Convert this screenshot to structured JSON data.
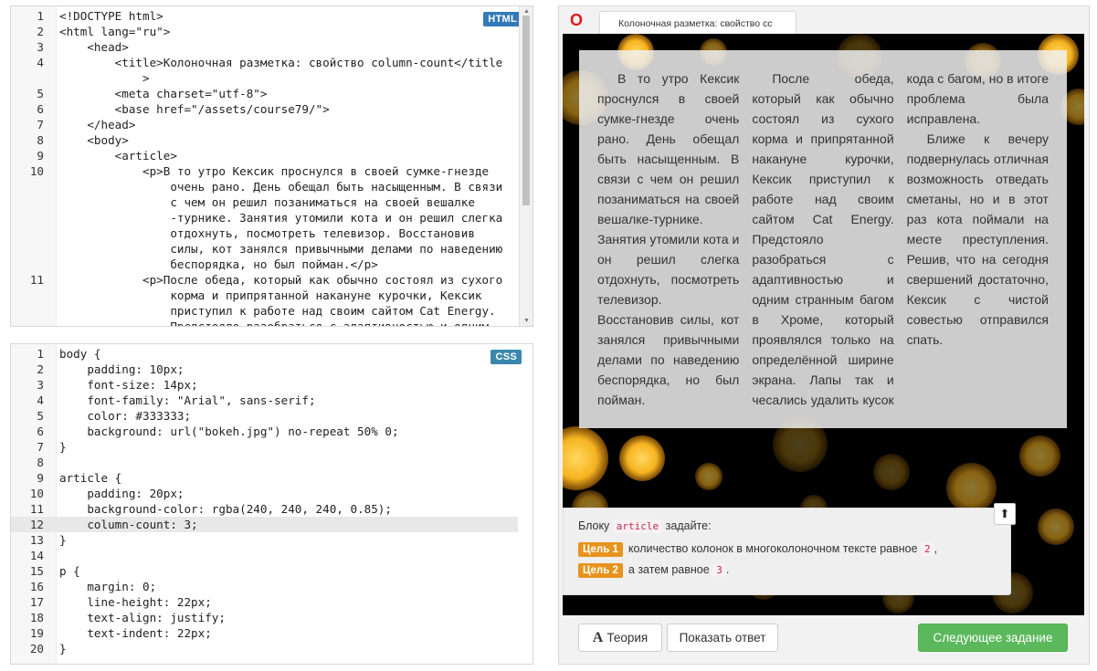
{
  "html_editor": {
    "badge": "HTML",
    "lines": [
      {
        "n": "1",
        "text": "<!DOCTYPE html>"
      },
      {
        "n": "2",
        "text": "<html lang=\"ru\">"
      },
      {
        "n": "3",
        "text": "    <head>"
      },
      {
        "n": "4",
        "text": "        <title>Колоночная разметка: свойство column-count</title"
      },
      {
        "n": "",
        "text": "            >"
      },
      {
        "n": "5",
        "text": "        <meta charset=\"utf-8\">"
      },
      {
        "n": "6",
        "text": "        <base href=\"/assets/course79/\">"
      },
      {
        "n": "7",
        "text": "    </head>"
      },
      {
        "n": "8",
        "text": "    <body>"
      },
      {
        "n": "9",
        "text": "        <article>"
      },
      {
        "n": "10",
        "text": "            <p>В то утро Кексик проснулся в своей сумке-гнезде"
      },
      {
        "n": "",
        "text": "                очень рано. День обещал быть насыщенным. В связи"
      },
      {
        "n": "",
        "text": "                с чем он решил позаниматься на своей вешалке"
      },
      {
        "n": "",
        "text": "                -турнике. Занятия утомили кота и он решил слегка"
      },
      {
        "n": "",
        "text": "                отдохнуть, посмотреть телевизор. Восстановив"
      },
      {
        "n": "",
        "text": "                силы, кот занялся привычными делами по наведению"
      },
      {
        "n": "",
        "text": "                беспорядка, но был пойман.</p>"
      },
      {
        "n": "11",
        "text": "            <p>После обеда, который как обычно состоял из сухого"
      },
      {
        "n": "",
        "text": "                корма и припрятанной накануне курочки, Кексик"
      },
      {
        "n": "",
        "text": "                приступил к работе над своим сайтом Cat Energy."
      },
      {
        "n": "",
        "text": "                Предстояло разобраться с адаптивностью и одним"
      }
    ]
  },
  "css_editor": {
    "badge": "CSS",
    "lines": [
      {
        "n": "1",
        "text": "body {"
      },
      {
        "n": "2",
        "text": "    padding: 10px;"
      },
      {
        "n": "3",
        "text": "    font-size: 14px;"
      },
      {
        "n": "4",
        "text": "    font-family: \"Arial\", sans-serif;"
      },
      {
        "n": "5",
        "text": "    color: #333333;"
      },
      {
        "n": "6",
        "text": "    background: url(\"bokeh.jpg\") no-repeat 50% 0;"
      },
      {
        "n": "7",
        "text": "}"
      },
      {
        "n": "8",
        "text": ""
      },
      {
        "n": "9",
        "text": "article {"
      },
      {
        "n": "10",
        "text": "    padding: 20px;"
      },
      {
        "n": "11",
        "text": "    background-color: rgba(240, 240, 240, 0.85);"
      },
      {
        "n": "12",
        "text": "    column-count: 3;"
      },
      {
        "n": "13",
        "text": "}"
      },
      {
        "n": "14",
        "text": ""
      },
      {
        "n": "15",
        "text": "p {"
      },
      {
        "n": "16",
        "text": "    margin: 0;"
      },
      {
        "n": "17",
        "text": "    line-height: 22px;"
      },
      {
        "n": "18",
        "text": "    text-align: justify;"
      },
      {
        "n": "19",
        "text": "    text-indent: 22px;"
      },
      {
        "n": "20",
        "text": "}"
      }
    ],
    "active_line": "12"
  },
  "preview": {
    "browser_icon": "opera-icon",
    "tab_title": "Колоночная разметка: свойство сс",
    "paragraphs": [
      "В то утро Кексик проснулся в своей сумке-гнезде очень рано. День обещал быть насыщенным. В связи с чем он решил позаниматься на своей вешалке-турнике. Занятия утомили кота и он решил слегка отдохнуть, посмотреть телевизор. Восстановив силы, кот занялся привычными делами по наведению беспорядка, но был пойман.",
      "После обеда, который как обычно состоял из сухого корма и припрятанной накануне курочки, Кексик приступил к работе над своим сайтом Cat Energy. Предстояло разобраться с адаптивностью и одним странным багом в Хроме, который проявлялся только на определённой ширине экрана. Лапы так и чесались удалить кусок кода с багом, но в итоге проблема была исправлена.",
      "Ближе к вечеру подвернулась отличная возможность отведать сметаны, но и в этот раз кота поймали на месте преступления. Решив, что на сегодня свершений достаточно, Кексик с чистой совестью отправился спать."
    ]
  },
  "task": {
    "intro_prefix": "Блоку",
    "intro_code": "article",
    "intro_suffix": "задайте:",
    "goals": [
      {
        "badge": "Цель 1",
        "text": "количество колонок в многоколоночном тексте равное",
        "value": "2",
        "tail": ","
      },
      {
        "badge": "Цель 2",
        "text": "а затем равное",
        "value": "3",
        "tail": "."
      }
    ],
    "up_button_icon": "arrow-up-icon"
  },
  "buttons": {
    "theory_icon": "A",
    "theory": "Теория",
    "show_answer": "Показать ответ",
    "next": "Следующее задание"
  },
  "colors": {
    "accent_blue": "#337ab7",
    "goal_orange": "#e8931d",
    "next_green": "#5cb85c",
    "opera_red": "#e0181a"
  }
}
